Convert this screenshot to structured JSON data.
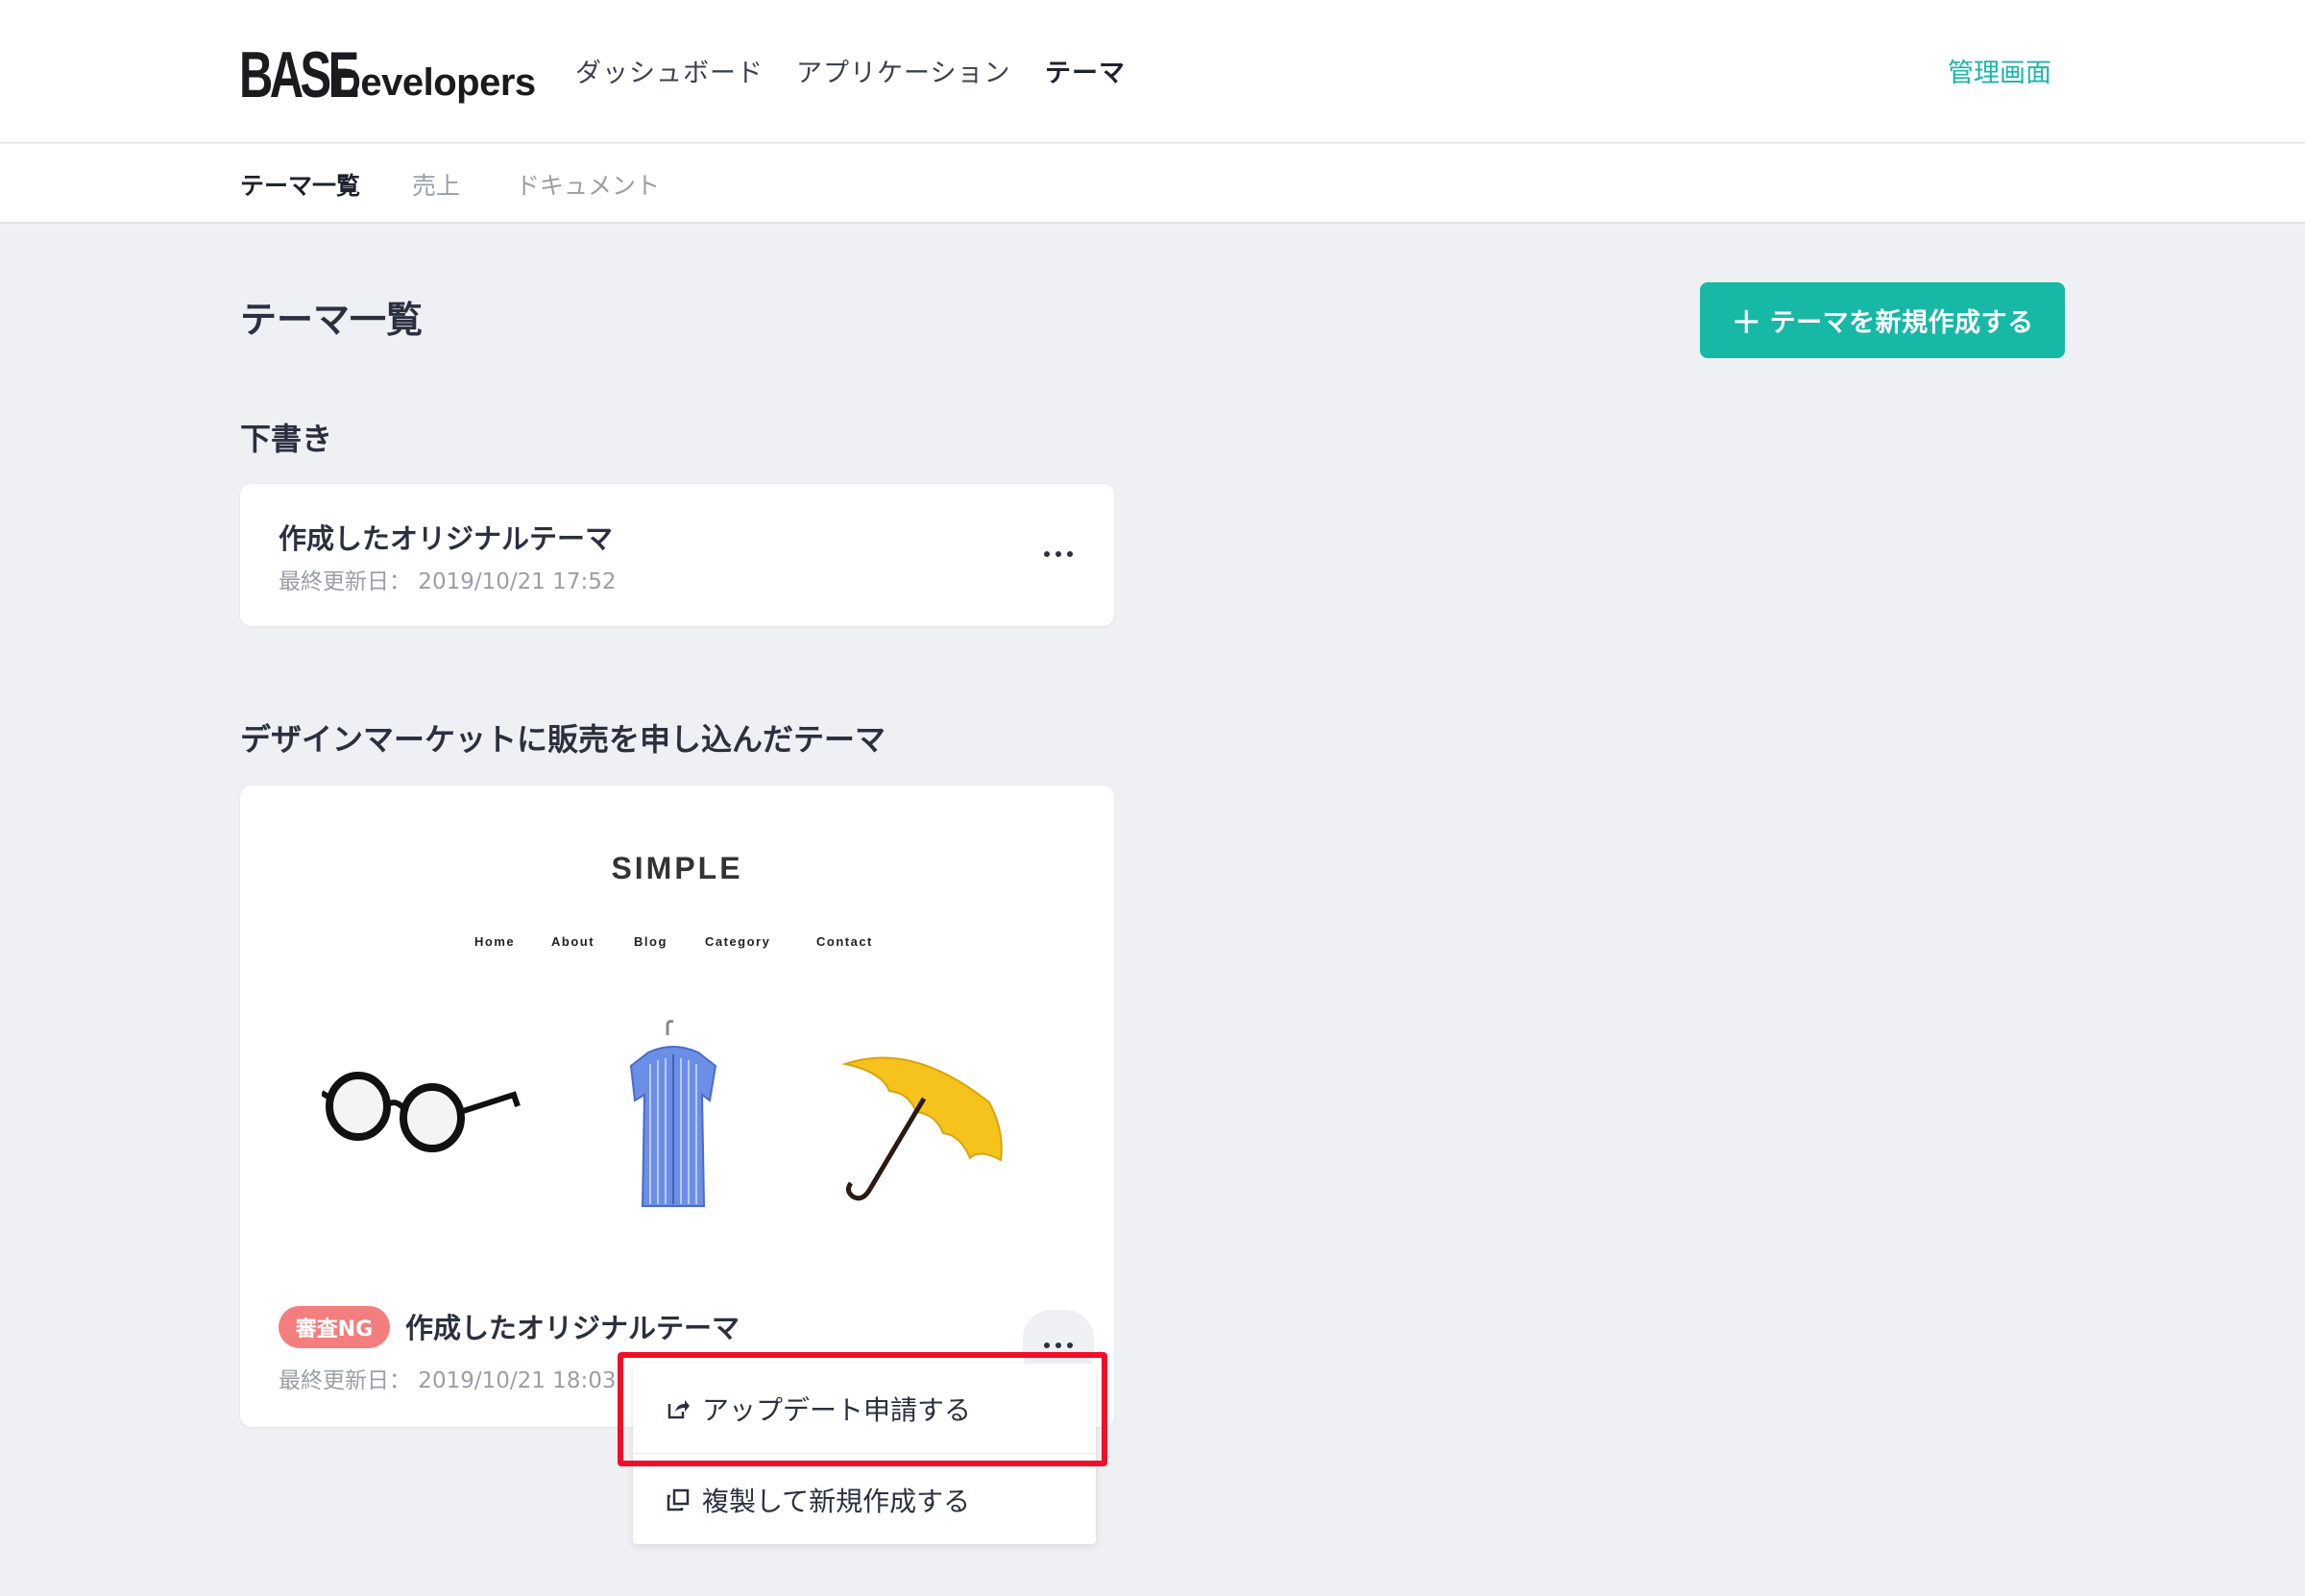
{
  "header": {
    "logo_base": "BASE",
    "logo_dev": "Developers",
    "nav": [
      "ダッシュボード",
      "アプリケーション",
      "テーマ"
    ],
    "admin_link": "管理画面"
  },
  "subnav": [
    "テーマ一覧",
    "売上",
    "ドキュメント"
  ],
  "page_title": "テーマ一覧",
  "new_button_label": "テーマを新規作成する",
  "drafts": {
    "section_title": "下書き",
    "item": {
      "title": "作成したオリジナルテーマ",
      "date": "最終更新日： 2019/10/21 17:52"
    }
  },
  "market": {
    "section_title": "デザインマーケットに販売を申し込んだテーマ",
    "preview": {
      "brand": "SIMPLE",
      "nav": [
        "Home",
        "About",
        "Blog",
        "Category",
        "Contact"
      ]
    },
    "item": {
      "badge": "審査NG",
      "title": "作成したオリジナルテーマ",
      "date": "最終更新日： 2019/10/21 18:03"
    }
  },
  "menu": {
    "items": [
      "アップデート申請する",
      "複製して新規作成する"
    ],
    "highlight_color": "#ef0f28"
  },
  "colors": {
    "accent": "#17b8a6",
    "badge_ng": "#f47e7e"
  }
}
